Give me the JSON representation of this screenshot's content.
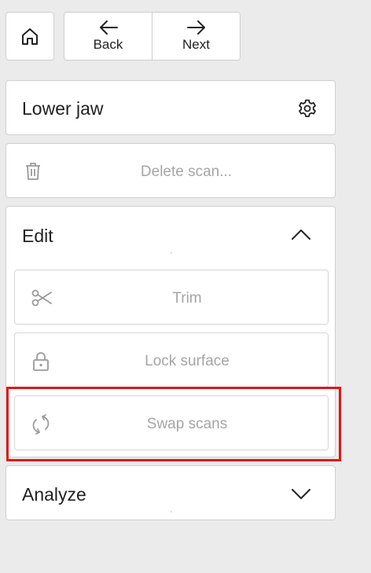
{
  "toolbar": {
    "home_icon": "home-icon",
    "back_label": "Back",
    "next_label": "Next"
  },
  "jaw_panel": {
    "title": "Lower jaw",
    "settings_icon": "gear-icon"
  },
  "delete_scan": {
    "label": "Delete scan...",
    "icon": "trash-icon"
  },
  "edit_section": {
    "title": "Edit",
    "expanded": true,
    "items": [
      {
        "label": "Trim",
        "icon": "scissors-icon",
        "enabled": false
      },
      {
        "label": "Lock surface",
        "icon": "lock-icon",
        "enabled": false
      },
      {
        "label": "Swap scans",
        "icon": "swap-icon",
        "enabled": false,
        "highlighted": true
      }
    ]
  },
  "analyze_section": {
    "title": "Analyze",
    "expanded": false
  },
  "colors": {
    "background": "#ebebeb",
    "card": "#ffffff",
    "border": "#cfcfcf",
    "disabled_text": "#a5a5a5",
    "highlight": "#e0161c"
  }
}
